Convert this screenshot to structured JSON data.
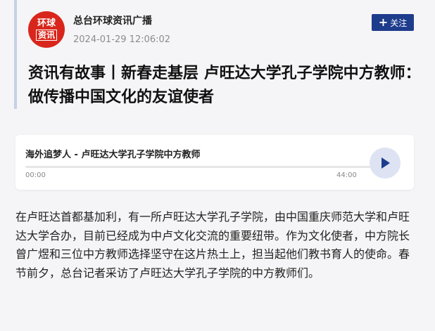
{
  "channel": {
    "logo_line1": "环球",
    "logo_line2": "资讯",
    "name": "总台环球资讯广播",
    "timestamp": "2024-01-29 12:06:02",
    "follow_label": "关注",
    "follow_icon": "plus-icon"
  },
  "article": {
    "title": "资讯有故事丨新春走基层 卢旺达大学孔子学院中方教师：做传播中国文化的友谊使者",
    "body": "在卢旺达首都基加利，有一所卢旺达大学孔子学院，由中国重庆师范大学和卢旺达大学合办，目前已经成为中卢文化交流的重要纽带。作为文化使者，中方院长曾广煜和三位中方教师选择坚守在这片热土上，担当起他们教书育人的使命。春节前夕，总台记者采访了卢旺达大学孔子学院的中方教师们。"
  },
  "audio": {
    "title": "海外追梦人 - 卢旺达大学孔子学院中方教师",
    "current_time": "00:00",
    "duration": "44:00",
    "progress": 0,
    "play_icon": "play-icon"
  },
  "colors": {
    "brand_red": "#d9261c",
    "accent_blue": "#1e3c8c"
  }
}
